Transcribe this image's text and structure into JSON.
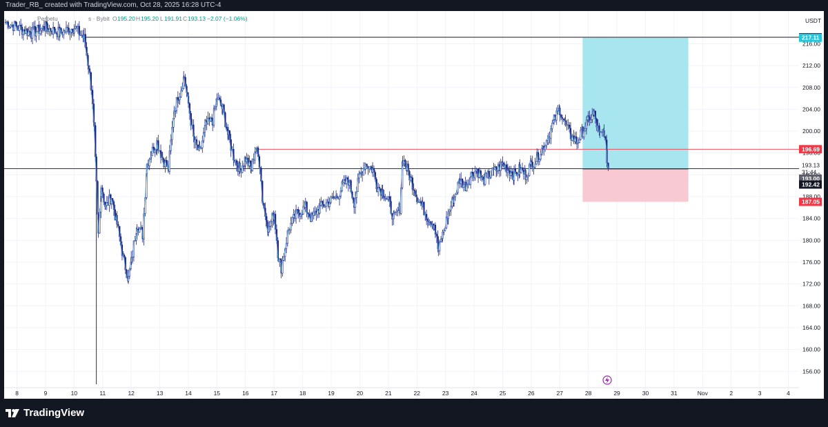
{
  "header": {
    "attribution": "Trader_RB_ created with TradingView.com, Oct 28, 2025 16:28 UTC-4"
  },
  "footer": {
    "brand": "TradingView"
  },
  "symbol_line": {
    "exchange": "Perpetu",
    "source": "s · Bybit",
    "open_label": "O",
    "open": "195.20",
    "high_label": "H",
    "high": "195.20",
    "low_label": "L",
    "low": "191.91",
    "close_label": "C",
    "close": "193.13",
    "change": "−2.07 (−1.06%)"
  },
  "colors": {
    "background": "#131722",
    "panel": "#ffffff",
    "candle": "#1a237e",
    "wick": "#1a237e",
    "line_overlay": "#5b9bd5",
    "profit_zone": "#a8e6ef",
    "loss_zone": "#f8c9d2",
    "target_label": "#26c6da",
    "stop_label": "#f23645",
    "resistance_line": "#f23645"
  },
  "chart_data": {
    "type": "candlestick",
    "currency": "USDT",
    "ylim": [
      153,
      222
    ],
    "y_ticks": [
      156,
      160,
      164,
      168,
      172,
      176,
      180,
      184,
      188,
      192,
      196,
      200,
      204,
      208,
      212,
      216
    ],
    "y_tick_labels": [
      "156.00",
      "160.00",
      "164.00",
      "168.00",
      "172.00",
      "176.00",
      "180.00",
      "184.00",
      "188.00",
      "192.00",
      "196.00",
      "200.00",
      "204.00",
      "208.00",
      "212.00",
      "216.00"
    ],
    "x_labels": [
      "8",
      "9",
      "10",
      "11",
      "12",
      "13",
      "14",
      "15",
      "16",
      "17",
      "18",
      "19",
      "20",
      "21",
      "22",
      "23",
      "24",
      "25",
      "26",
      "27",
      "28",
      "29",
      "30",
      "31",
      "Nov",
      "2",
      "3",
      "4"
    ],
    "x_range": [
      7.6,
      35.35
    ],
    "close_path": [
      [
        7.6,
        220
      ],
      [
        8.0,
        219
      ],
      [
        8.5,
        218
      ],
      [
        9.0,
        219
      ],
      [
        9.5,
        218
      ],
      [
        10.0,
        219
      ],
      [
        10.35,
        217
      ],
      [
        10.5,
        212
      ],
      [
        10.6,
        208
      ],
      [
        10.7,
        200
      ],
      [
        10.78,
        190
      ],
      [
        10.85,
        181
      ],
      [
        10.95,
        190
      ],
      [
        11.1,
        186
      ],
      [
        11.3,
        188
      ],
      [
        11.5,
        183
      ],
      [
        11.75,
        176
      ],
      [
        11.9,
        173
      ],
      [
        12.0,
        176
      ],
      [
        12.2,
        183
      ],
      [
        12.4,
        181
      ],
      [
        12.55,
        194
      ],
      [
        12.7,
        196
      ],
      [
        12.9,
        198
      ],
      [
        13.1,
        195
      ],
      [
        13.3,
        193
      ],
      [
        13.5,
        204
      ],
      [
        13.7,
        207
      ],
      [
        13.85,
        210
      ],
      [
        14.0,
        205
      ],
      [
        14.2,
        198
      ],
      [
        14.4,
        196
      ],
      [
        14.6,
        201
      ],
      [
        14.85,
        202
      ],
      [
        15.0,
        206
      ],
      [
        15.2,
        204
      ],
      [
        15.4,
        199
      ],
      [
        15.6,
        195
      ],
      [
        15.8,
        193
      ],
      [
        16.0,
        195
      ],
      [
        16.2,
        193
      ],
      [
        16.35,
        197
      ],
      [
        16.5,
        194
      ],
      [
        16.6,
        187
      ],
      [
        16.8,
        182
      ],
      [
        17.0,
        185
      ],
      [
        17.15,
        177
      ],
      [
        17.25,
        175
      ],
      [
        17.5,
        182
      ],
      [
        17.8,
        185
      ],
      [
        18.1,
        186
      ],
      [
        18.3,
        184
      ],
      [
        18.6,
        186
      ],
      [
        18.9,
        187
      ],
      [
        19.2,
        188
      ],
      [
        19.4,
        190
      ],
      [
        19.6,
        191
      ],
      [
        19.8,
        187
      ],
      [
        20.0,
        192
      ],
      [
        20.2,
        194
      ],
      [
        20.45,
        193
      ],
      [
        20.6,
        190
      ],
      [
        20.8,
        189
      ],
      [
        21.0,
        187
      ],
      [
        21.2,
        184
      ],
      [
        21.4,
        186
      ],
      [
        21.5,
        195
      ],
      [
        21.65,
        193
      ],
      [
        21.8,
        191
      ],
      [
        22.0,
        188
      ],
      [
        22.2,
        186
      ],
      [
        22.4,
        184
      ],
      [
        22.6,
        183
      ],
      [
        22.75,
        178
      ],
      [
        22.9,
        181
      ],
      [
        23.1,
        185
      ],
      [
        23.3,
        188
      ],
      [
        23.5,
        191
      ],
      [
        23.7,
        190
      ],
      [
        23.9,
        192
      ],
      [
        24.1,
        193
      ],
      [
        24.3,
        191
      ],
      [
        24.55,
        192
      ],
      [
        24.8,
        193
      ],
      [
        25.0,
        194
      ],
      [
        25.2,
        193
      ],
      [
        25.4,
        192
      ],
      [
        25.6,
        193
      ],
      [
        25.8,
        192
      ],
      [
        26.0,
        194
      ],
      [
        26.2,
        195
      ],
      [
        26.4,
        197
      ],
      [
        26.6,
        199
      ],
      [
        26.8,
        202
      ],
      [
        27.0,
        204
      ],
      [
        27.2,
        201
      ],
      [
        27.4,
        199
      ],
      [
        27.6,
        198
      ],
      [
        27.8,
        200
      ],
      [
        28.0,
        202
      ],
      [
        28.2,
        203
      ],
      [
        28.4,
        199
      ],
      [
        28.55,
        200
      ],
      [
        28.65,
        195
      ],
      [
        28.7,
        193.13
      ]
    ],
    "resistance_level": {
      "price": 196.69,
      "label": "196.69",
      "from_x": 16.35
    },
    "range_line": {
      "price": 217.2,
      "label": "217.20",
      "from_x": 10.35
    },
    "last_price": {
      "price": 193.13,
      "label": "193.13",
      "countdown": "31:44"
    },
    "entry_level": {
      "price": 193.0,
      "label": "193.00"
    },
    "sub_level": {
      "price": 192.42,
      "label": "192.42"
    },
    "position_tool": {
      "start_x": 27.8,
      "end_x": 31.5,
      "entry": 193.0,
      "target": 217.11,
      "target_label": "217.11",
      "stop": 187.05,
      "stop_label": "187.05"
    },
    "vertical_marker_x": 10.78
  }
}
